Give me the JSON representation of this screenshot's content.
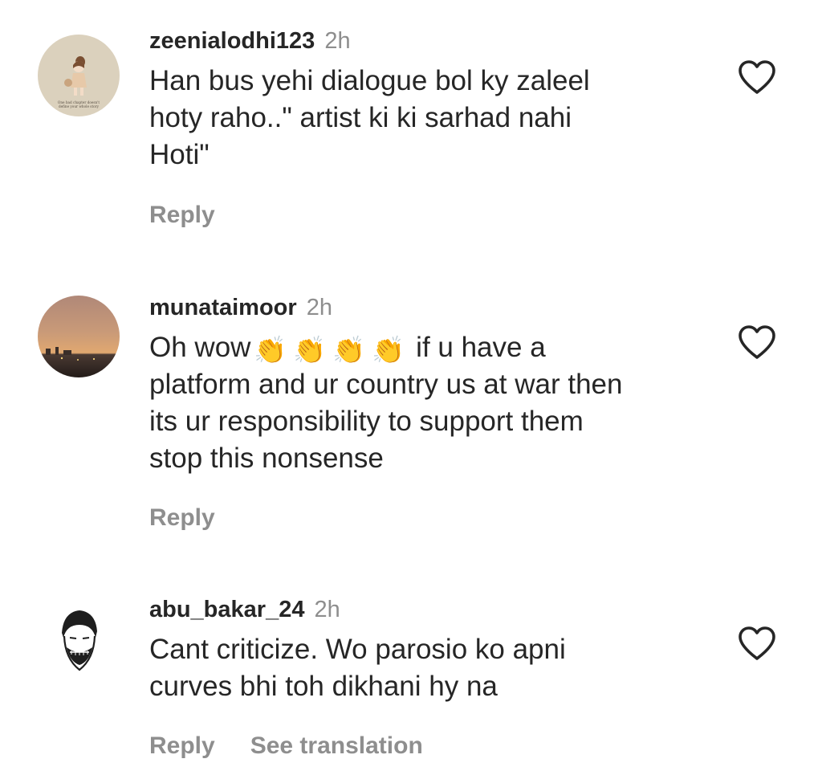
{
  "comments": [
    {
      "username": "zeenialodhi123",
      "time": "2h",
      "text": "Han bus yehi dialogue bol ky zaleel\nhoty raho..\" artist ki ki sarhad nahi\nHoti\"",
      "avatar_caption": "One bad chapter doesn't define your whole story",
      "reply_label": "Reply"
    },
    {
      "username": "munataimoor",
      "time": "2h",
      "text_before": "Oh wow",
      "emoji": [
        "👏",
        "👏",
        "👏",
        "👏"
      ],
      "text_after": " if u have a\nplatform and ur country us at war then\nits ur responsibility to support them\nstop this nonsense",
      "reply_label": "Reply"
    },
    {
      "username": "abu_bakar_24",
      "time": "2h",
      "text": "Cant criticize. Wo parosio ko apni\ncurves bhi toh dikhani hy na",
      "reply_label": "Reply",
      "see_translation_label": "See translation"
    }
  ],
  "icons": {
    "like": "heart-outline-icon"
  },
  "colors": {
    "text": "#262626",
    "secondary": "#8e8e8e",
    "background": "#ffffff"
  }
}
